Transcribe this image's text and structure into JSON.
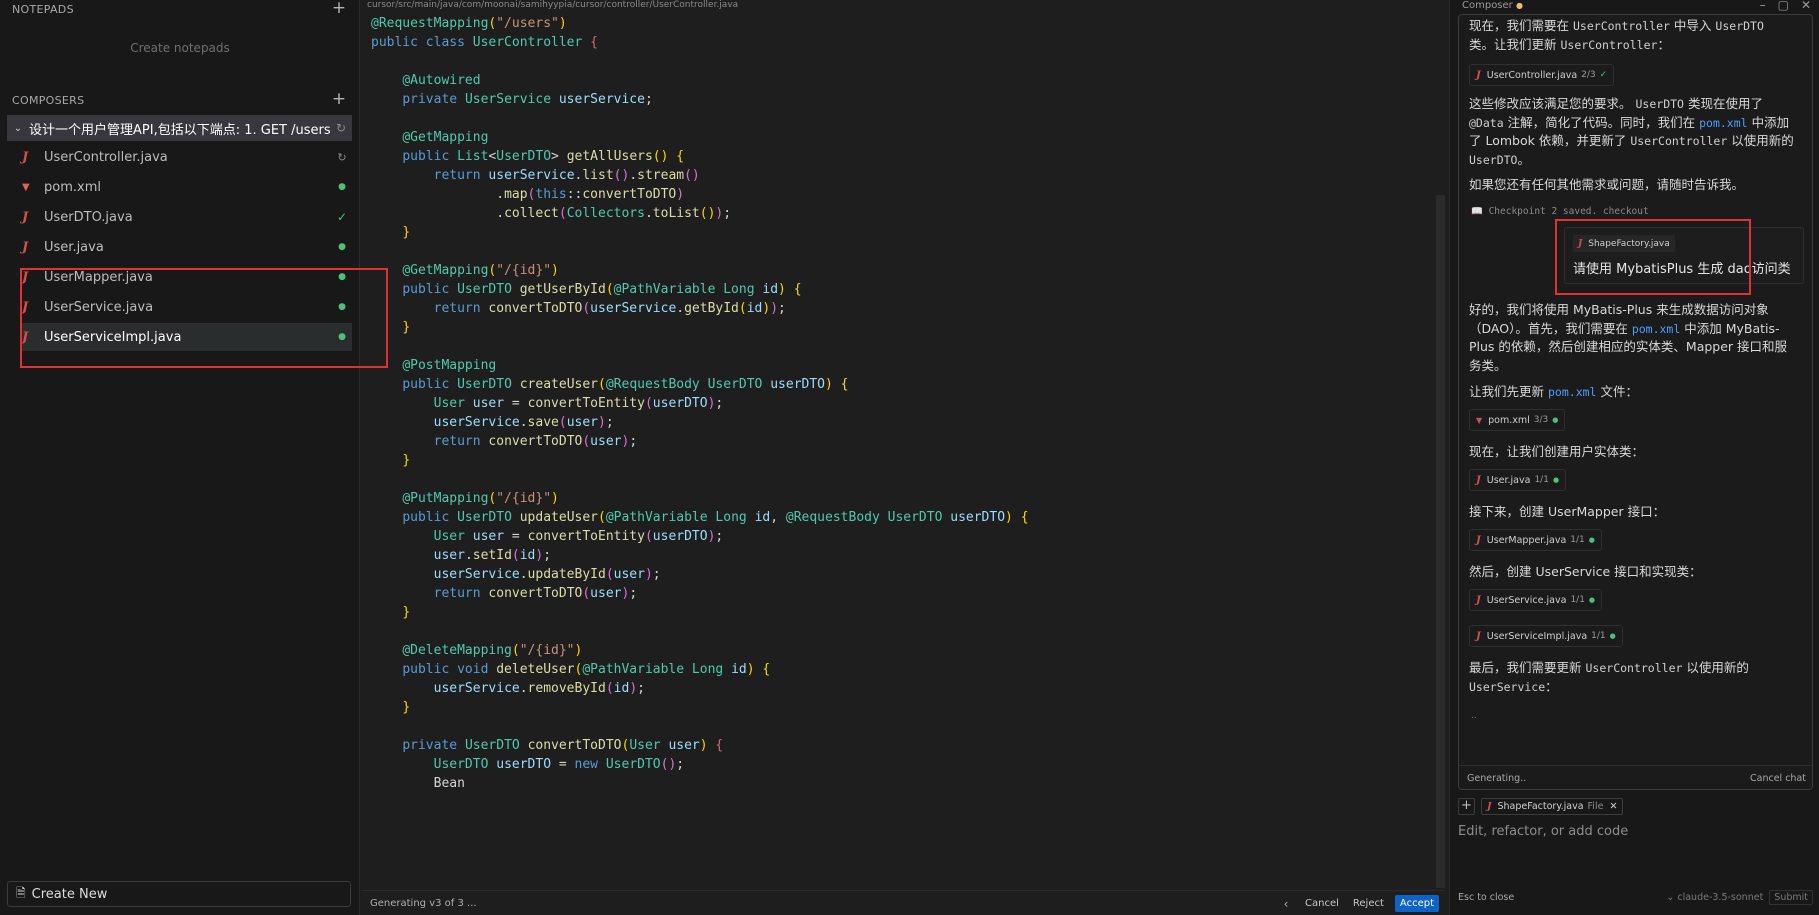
{
  "left_panel": {
    "notepads_header": "NOTEPADS",
    "create_notepads": "Create notepads",
    "composers_header": "COMPOSERS",
    "composer_title": "设计一个用户管理API,包括以下端点: 1. GET /users...",
    "files": [
      {
        "name": "UserController.java",
        "icon": "java-icon",
        "status": "loading"
      },
      {
        "name": "pom.xml",
        "icon": "xml-icon",
        "status": "dot"
      },
      {
        "name": "UserDTO.java",
        "icon": "java-icon",
        "status": "check"
      },
      {
        "name": "User.java",
        "icon": "java-icon",
        "status": "dot"
      },
      {
        "name": "UserMapper.java",
        "icon": "java-icon",
        "status": "dot"
      },
      {
        "name": "UserService.java",
        "icon": "java-icon",
        "status": "dot"
      },
      {
        "name": "UserServiceImpl.java",
        "icon": "java-icon",
        "status": "dot"
      }
    ],
    "create_new": "Create New"
  },
  "editor": {
    "breadcrumb": "cursor/src/main/java/com/moonai/samihyypia/cursor/controller/UserController.java",
    "status": "Generating v3 of 3 ...",
    "cancel": "Cancel",
    "reject": "Reject",
    "accept": "Accept"
  },
  "composer_panel": {
    "header": "Composer",
    "msg1_a": "现在，我们需要在",
    "msg1_code1": "UserController",
    "msg1_b": "中导入",
    "msg1_code2": "UserDTO",
    "msg1_c": "类。让我们更新",
    "msg1_code3": "UserController",
    "msg1_d": "：",
    "chip1": {
      "name": "UserController.java",
      "count": "2/3"
    },
    "msg2_a": "这些修改应该满足您的要求。",
    "msg2_code1": "UserDTO",
    "msg2_b": "类现在使用了",
    "msg2_code2": "@Data",
    "msg2_c": "注解，简化了代码。同时，我们在",
    "msg2_code3": "pom.xml",
    "msg2_d": "中添加了 Lombok 依赖，并更新了",
    "msg2_code4": "UserController",
    "msg2_e": "以使用新的",
    "msg2_code5": "UserDTO",
    "msg2_f": "。",
    "msg3": "如果您还有任何其他需求或问题，请随时告诉我。",
    "checkpoint": "Checkpoint 2 saved. checkout",
    "user_chip": "ShapeFactory.java",
    "user_text": "请使用 MybatisPlus 生成 dao访问类",
    "msg4": "好的，我们将使用 MyBatis-Plus 来生成数据访问对象（DAO）。首先，我们需要在",
    "msg4_code": "pom.xml",
    "msg4_b": "中添加 MyBatis-Plus 的依赖，然后创建相应的实体类、Mapper 接口和服务类。",
    "msg5_a": "让我们先更新",
    "msg5_code": "pom.xml",
    "msg5_b": "文件：",
    "chip2": {
      "name": "pom.xml",
      "count": "3/3"
    },
    "msg6": "现在，让我们创建用户实体类：",
    "chip3": {
      "name": "User.java",
      "count": "1/1"
    },
    "msg7": "接下来，创建 UserMapper 接口：",
    "chip4": {
      "name": "UserMapper.java",
      "count": "1/1"
    },
    "msg8": "然后，创建 UserService 接口和实现类：",
    "chip5": {
      "name": "UserService.java",
      "count": "1/1"
    },
    "chip6": {
      "name": "UserServiceImpl.java",
      "count": "1/1"
    },
    "msg9_a": "最后，我们需要更新",
    "msg9_code1": "UserController",
    "msg9_b": "以使用新的",
    "msg9_code2": "UserService",
    "msg9_c": "：",
    "ellipsis": "..",
    "generating": "Generating..",
    "cancel_chat": "Cancel chat",
    "context_chip": {
      "name": "ShapeFactory.java",
      "kind": "File"
    },
    "input_placeholder": "Edit, refactor, or add code",
    "esc_hint": "Esc to close",
    "model": "claude-3.5-sonnet",
    "submit": "Submit"
  },
  "colors": {
    "accent": "#0e63c8",
    "highlight_box": "#e03232",
    "status_green": "#4ec07a",
    "java_icon": "#d05050"
  }
}
